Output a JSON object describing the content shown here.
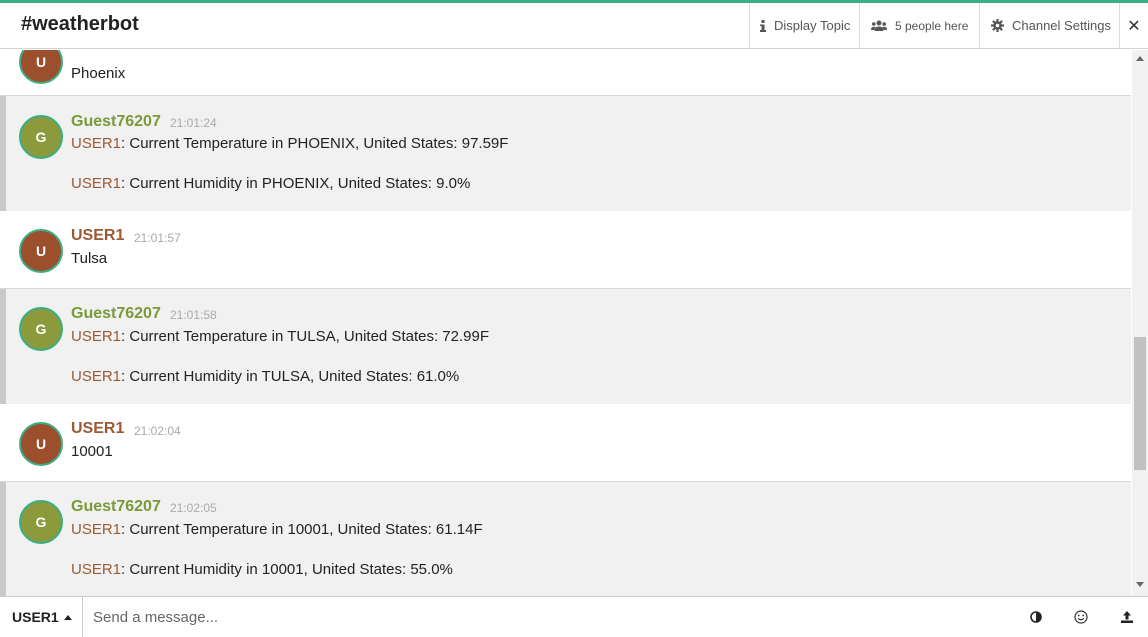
{
  "header": {
    "channel": "#weatherbot",
    "display_topic": "Display Topic",
    "people": "5 people here",
    "settings": "Channel Settings",
    "close": "✕"
  },
  "messages": [
    {
      "kind": "user",
      "avatar": "U",
      "nick": "USER1",
      "time": "",
      "lines": [
        "Phoenix"
      ]
    },
    {
      "kind": "bot",
      "avatar": "G",
      "nick": "Guest76207",
      "time": "21:01:24",
      "lines": [
        {
          "mention": "USER1",
          "text": ": Current Temperature in PHOENIX, United States: 97.59F"
        },
        {
          "mention": "USER1",
          "text": ": Current Humidity in PHOENIX, United States: 9.0%"
        }
      ]
    },
    {
      "kind": "user",
      "avatar": "U",
      "nick": "USER1",
      "time": "21:01:57",
      "lines": [
        "Tulsa"
      ]
    },
    {
      "kind": "bot",
      "avatar": "G",
      "nick": "Guest76207",
      "time": "21:01:58",
      "lines": [
        {
          "mention": "USER1",
          "text": ": Current Temperature in TULSA, United States: 72.99F"
        },
        {
          "mention": "USER1",
          "text": ": Current Humidity in TULSA, United States: 61.0%"
        }
      ]
    },
    {
      "kind": "user",
      "avatar": "U",
      "nick": "USER1",
      "time": "21:02:04",
      "lines": [
        "10001"
      ]
    },
    {
      "kind": "bot",
      "avatar": "G",
      "nick": "Guest76207",
      "time": "21:02:05",
      "lines": [
        {
          "mention": "USER1",
          "text": ": Current Temperature in 10001, United States: 61.14F"
        },
        {
          "mention": "USER1",
          "text": ": Current Humidity in 10001, United States: 55.0%"
        }
      ]
    }
  ],
  "composer": {
    "nick": "USER1",
    "placeholder": "Send a message...",
    "icons": [
      "contrast-icon",
      "emoji-icon",
      "upload-icon"
    ]
  },
  "colors": {
    "accent": "#3aaf85",
    "user_nick": "#9b5a33",
    "bot_nick": "#7a9a37"
  }
}
